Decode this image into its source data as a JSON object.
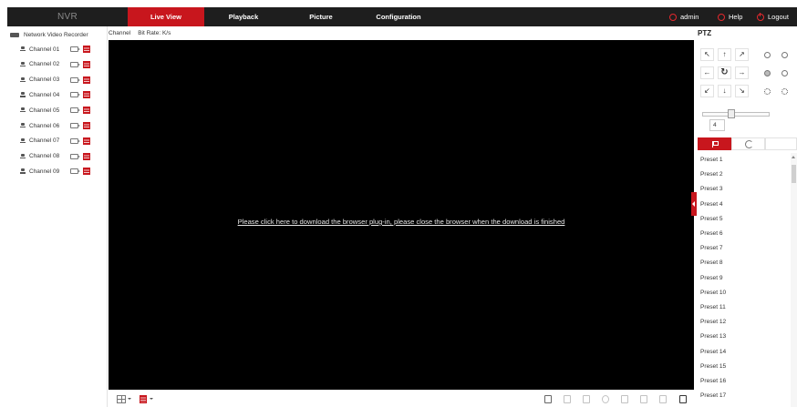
{
  "topbar": {
    "brand": "NVR",
    "tabs": [
      "Live View",
      "Playback",
      "Picture",
      "Configuration"
    ],
    "active_tab": "Live View",
    "user": "admin",
    "help": "Help",
    "logout": "Logout",
    "accent_color": "#c8161d"
  },
  "sidebar": {
    "device": "Network Video Recorder",
    "channels": [
      "Channel 01",
      "Channel 02",
      "Channel 03",
      "Channel 04",
      "Channel 05",
      "Channel 06",
      "Channel 07",
      "Channel 08",
      "Channel 09"
    ]
  },
  "info": {
    "channel_label": "Channel",
    "bitrate_label": "Bit Rate: K/s"
  },
  "video": {
    "message": "Please click here to download the browser plug-in, please close the browser when the download is finished"
  },
  "ptz": {
    "title": "PTZ",
    "speed": "4",
    "speed_min": 1,
    "speed_max": 8,
    "directions": [
      "↖",
      "↑",
      "↗",
      "←",
      "↻",
      "→",
      "↙",
      "↓",
      "↘"
    ],
    "presets": [
      "Preset 1",
      "Preset 2",
      "Preset 3",
      "Preset 4",
      "Preset 5",
      "Preset 6",
      "Preset 7",
      "Preset 8",
      "Preset 9",
      "Preset 10",
      "Preset 11",
      "Preset 12",
      "Preset 13",
      "Preset 14",
      "Preset 15",
      "Preset 16",
      "Preset 17"
    ]
  }
}
